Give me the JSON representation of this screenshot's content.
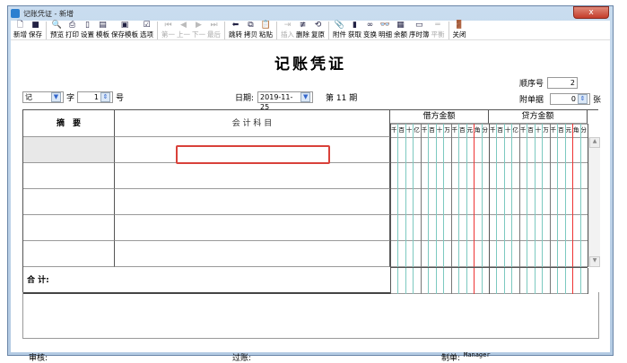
{
  "window": {
    "title": "记账凭证 - 新增",
    "close_icon": "x"
  },
  "toolbar": [
    {
      "label": "新增",
      "icon": "🗋",
      "enabled": true
    },
    {
      "label": "保存",
      "icon": "■",
      "enabled": true
    },
    null,
    {
      "label": "预览",
      "icon": "🔍",
      "enabled": true
    },
    {
      "label": "打印",
      "icon": "⎙",
      "enabled": true
    },
    {
      "label": "设置",
      "icon": "▯",
      "enabled": true
    },
    {
      "label": "模板",
      "icon": "▤",
      "enabled": true
    },
    {
      "label": "保存模板",
      "icon": "▣",
      "enabled": true
    },
    {
      "label": "选项",
      "icon": "☑",
      "enabled": true
    },
    null,
    {
      "label": "第一",
      "icon": "⏮",
      "enabled": false
    },
    {
      "label": "上一",
      "icon": "◀",
      "enabled": false
    },
    {
      "label": "下一",
      "icon": "▶",
      "enabled": false
    },
    {
      "label": "最后",
      "icon": "⏭",
      "enabled": false
    },
    null,
    {
      "label": "跳转",
      "icon": "⬅",
      "enabled": true
    },
    {
      "label": "拷贝",
      "icon": "⧉",
      "enabled": true
    },
    {
      "label": "粘贴",
      "icon": "📋",
      "enabled": true
    },
    null,
    {
      "label": "插入",
      "icon": "⇥",
      "enabled": false
    },
    {
      "label": "删除",
      "icon": "≢",
      "enabled": true
    },
    {
      "label": "复原",
      "icon": "⟲",
      "enabled": true
    },
    null,
    {
      "label": "附件",
      "icon": "📎",
      "enabled": true
    },
    {
      "label": "获取",
      "icon": "▮",
      "enabled": true
    },
    {
      "label": "变换",
      "icon": "∞",
      "enabled": true
    },
    {
      "label": "明细",
      "icon": "👓",
      "enabled": true
    },
    {
      "label": "余额",
      "icon": "▦",
      "enabled": true
    },
    {
      "label": "序时簿",
      "icon": "▭",
      "enabled": true
    },
    {
      "label": "平衡",
      "icon": "═",
      "enabled": false
    },
    null,
    {
      "label": "关闭",
      "icon": "🚪",
      "enabled": true
    }
  ],
  "voucher": {
    "title": "记账凭证",
    "word": "记",
    "word_label": "字",
    "number": "1",
    "number_label": "号",
    "date_label": "日期:",
    "date": "2019-11-25",
    "period": "第 11 期",
    "seq_label": "顺序号",
    "seq": "2",
    "attach_label": "附单据",
    "attach": "0",
    "attach_unit": "张"
  },
  "table": {
    "col_summary": "摘　要",
    "col_account": "会 计 科 目",
    "col_debit": "借方金额",
    "col_credit": "贷方金额",
    "digits": [
      "千",
      "百",
      "十",
      "亿",
      "千",
      "百",
      "十",
      "万",
      "千",
      "百",
      "十",
      "元",
      "角",
      "分"
    ],
    "total_label": "合  计:"
  },
  "footer": {
    "review_label": "审核:",
    "post_label": "过账:",
    "maker_label": "制单:",
    "maker": "Manager"
  }
}
